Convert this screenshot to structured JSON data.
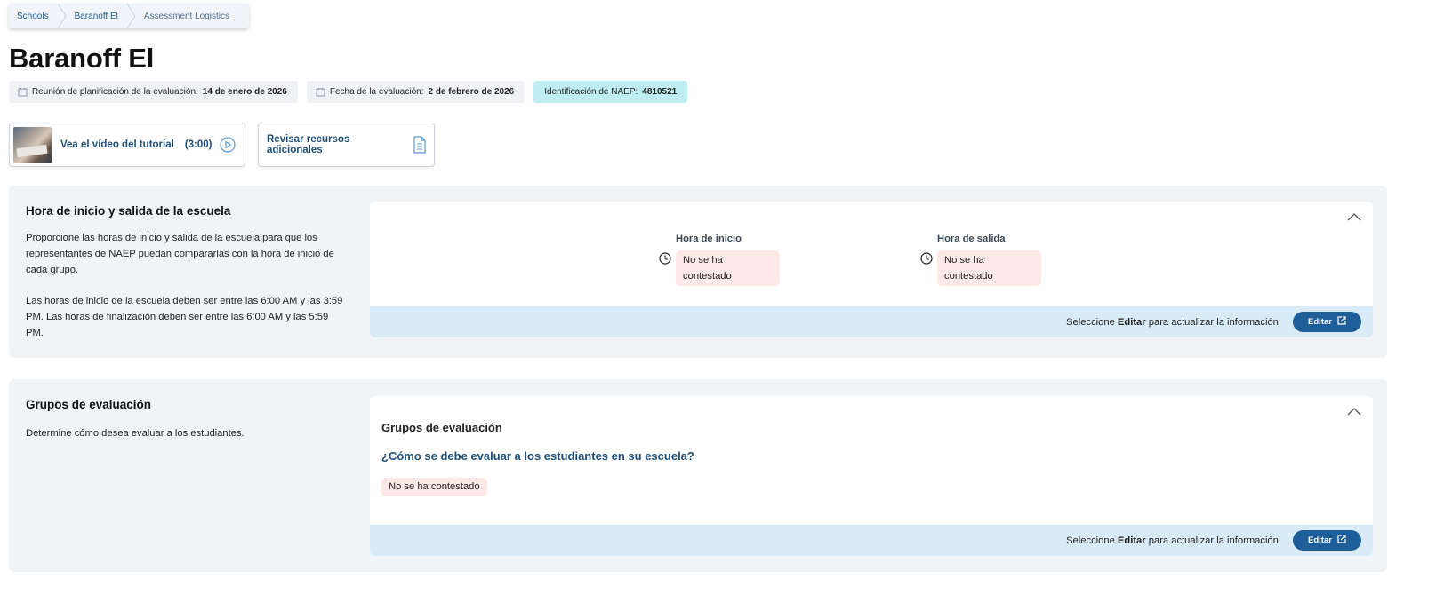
{
  "breadcrumb": {
    "items": [
      "Schools",
      "Baranoff El",
      "Assessment Logistics"
    ]
  },
  "page": {
    "title": "Baranoff El"
  },
  "meta": {
    "planning_meeting_label": "Reunión de planificación de la evaluación:",
    "planning_meeting_value": "14 de enero de 2026",
    "assessment_date_label": "Fecha de la evaluación:",
    "assessment_date_value": "2 de febrero de 2026",
    "naep_id_label": "Identificación de NAEP:",
    "naep_id_value": "4810521"
  },
  "resources": {
    "video_label": "Vea el vídeo del tutorial",
    "video_duration": "(3:00)",
    "additional_label": "Revisar recursos adicionales"
  },
  "school_hours": {
    "title": "Hora de inicio y salida de la escuela",
    "description_1": "Proporcione las horas de inicio y salida de la escuela para que los representantes de NAEP puedan compararlas con la hora de inicio de cada grupo.",
    "description_2": "Las horas de inicio de la escuela deben ser entre las 6:00 AM y las 3:59 PM. Las horas de finalización deben ser entre las 6:00 AM y las 5:59 PM.",
    "start_label": "Hora de inicio",
    "start_value": "No se ha contestado",
    "end_label": "Hora de salida",
    "end_value": "No se ha contestado",
    "footer_prefix": "Seleccione",
    "footer_bold": "Editar",
    "footer_suffix": "para actualizar la información.",
    "edit_label": "Editar"
  },
  "groups": {
    "title": "Grupos de evaluación",
    "description": "Determine cómo desea evaluar a los estudiantes.",
    "panel_title": "Grupos de evaluación",
    "question": "¿Cómo se debe evaluar a los estudiantes en su escuela?",
    "answer": "No se ha contestado",
    "footer_prefix": "Seleccione",
    "footer_bold": "Editar",
    "footer_suffix": "para actualizar la información.",
    "edit_label": "Editar"
  },
  "colors": {
    "primary": "#1e5f9a",
    "link": "#1f4f78",
    "section_bg": "#f1f4f7",
    "footer_bg": "#d9ebf7",
    "unanswered_bg": "#fde8e8",
    "naep_pill_bg": "#bfeef2"
  },
  "icons": {
    "calendar": "calendar-icon",
    "play": "play-circle-icon",
    "document": "document-icon",
    "clock": "clock-icon",
    "chevron": "chevron-up-icon",
    "edit": "edit-external-icon"
  }
}
